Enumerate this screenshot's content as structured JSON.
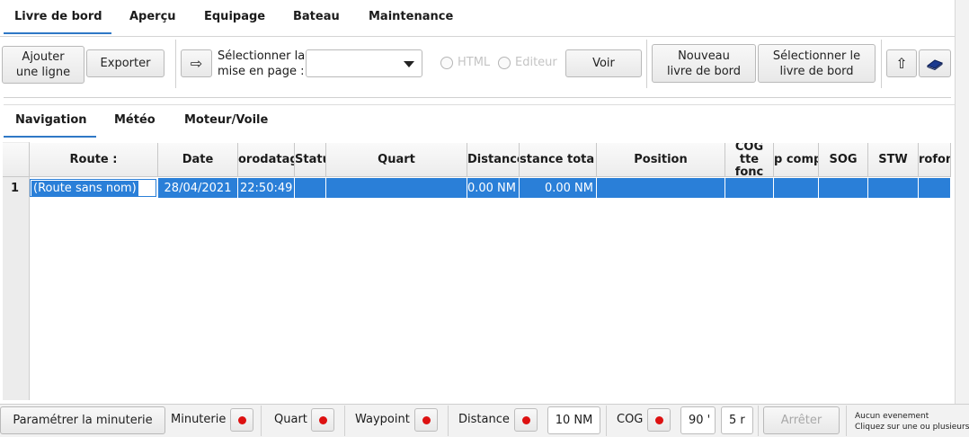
{
  "top_tabs": [
    "Livre de bord",
    "Aperçu",
    "Equipage",
    "Bateau",
    "Maintenance"
  ],
  "toolbar": {
    "add_line": "Ajouter une ligne",
    "export": "Exporter",
    "select_layout_label": "Sélectionner la mise en page :",
    "combo_value": "",
    "radio_html": "HTML",
    "radio_editor": "Editeur",
    "view": "Voir",
    "new_log": "Nouveau livre de bord",
    "select_log": "Sélectionner le livre de bord"
  },
  "sub_tabs": [
    "Navigation",
    "Météo",
    "Moteur/Voile"
  ],
  "table": {
    "columns": [
      "Route :",
      "Date",
      "orodatag",
      "Statu",
      "Quart",
      "Distance",
      "stance tota",
      "Position",
      "COG tte fonc",
      "p comp",
      "SOG",
      "STW",
      "rofon"
    ],
    "rows": [
      {
        "index": "1",
        "route": "(Route sans nom)",
        "date": "28/04/2021",
        "time": "22:50:49",
        "status": "",
        "quart": "",
        "distance": "0.00 NM",
        "distance_total": "0.00 NM",
        "position": "",
        "cog": "",
        "comp": "",
        "sog": "",
        "stw": "",
        "depth": ""
      }
    ]
  },
  "bottom": {
    "timer_button": "Paramétrer la minuterie",
    "timer_label": "Minuterie",
    "quart_label": "Quart",
    "waypoint_label": "Waypoint",
    "distance_label": "Distance",
    "distance_value": "10 NM",
    "cog_label": "COG",
    "cog_value": "90 '",
    "cog_value2": "5 r",
    "stop_button": "Arrêter",
    "event_line1": "Aucun evenement",
    "event_line2": "Cliquez sur une ou plusieurs"
  },
  "colors": {
    "accent": "#2f78c6",
    "selection": "#2a7fd8",
    "led": "#dd1111"
  }
}
